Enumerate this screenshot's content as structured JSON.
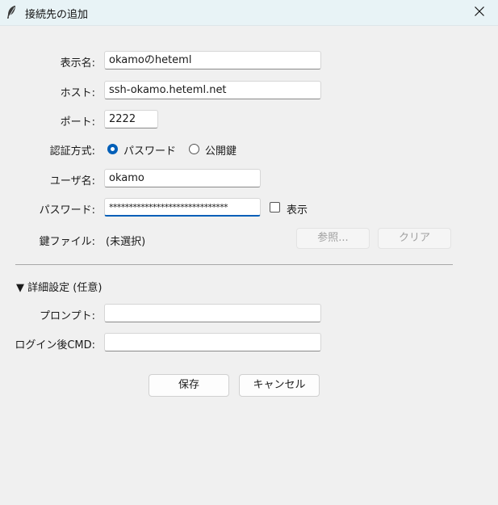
{
  "window": {
    "title": "接続先の追加",
    "app_icon": "feather-icon",
    "close_icon": "close-icon"
  },
  "form": {
    "display_name": {
      "label": "表示名:",
      "value": "okamoのheteml"
    },
    "host": {
      "label": "ホスト:",
      "value": "ssh-okamo.heteml.net"
    },
    "port": {
      "label": "ポート:",
      "value": "2222"
    },
    "auth": {
      "label": "認証方式:",
      "options": [
        {
          "label": "パスワード",
          "selected": true
        },
        {
          "label": "公開鍵",
          "selected": false
        }
      ]
    },
    "username": {
      "label": "ユーザ名:",
      "value": "okamo"
    },
    "password": {
      "label": "パスワード:",
      "value": "******************************",
      "show_label": "表示",
      "show_checked": false
    },
    "keyfile": {
      "label": "鍵ファイル:",
      "value": "(未選択)",
      "browse_label": "参照...",
      "clear_label": "クリア"
    }
  },
  "advanced": {
    "header": "▼ 詳細設定 (任意)",
    "prompt": {
      "label": "プロンプト:",
      "value": ""
    },
    "post_login_cmd": {
      "label": "ログイン後CMD:",
      "value": ""
    }
  },
  "buttons": {
    "save_label": "保存",
    "cancel_label": "キャンセル"
  },
  "colors": {
    "accent": "#005fb8",
    "titlebar": "#e8f3f6",
    "background": "#f0f0f0"
  }
}
